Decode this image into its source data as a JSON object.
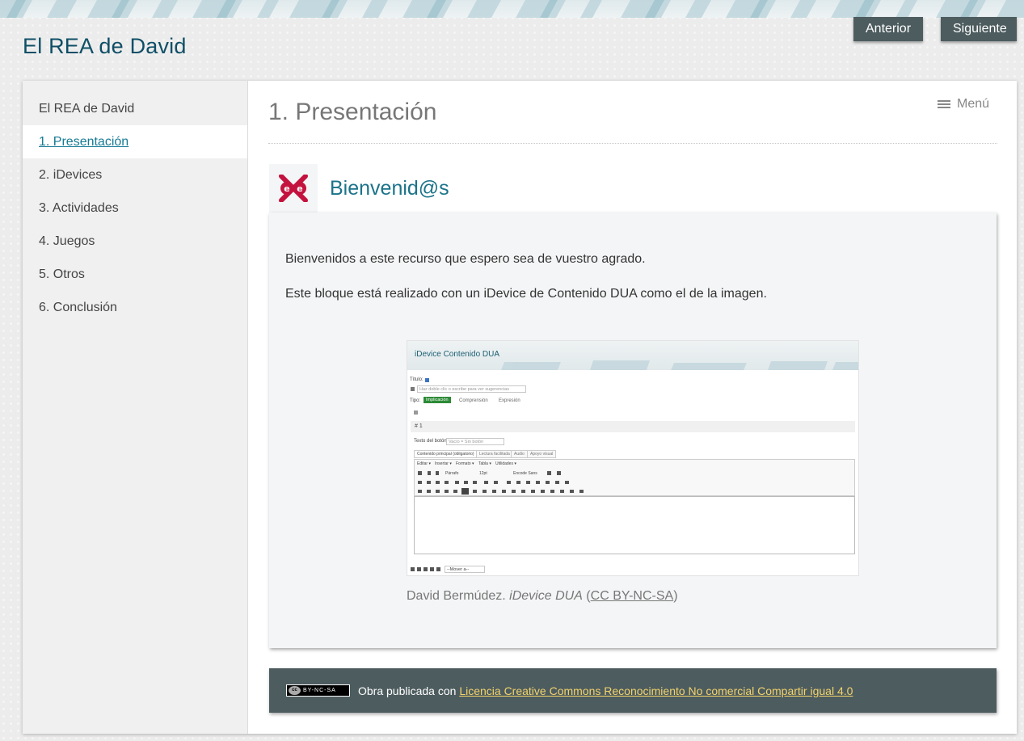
{
  "site": {
    "title": "El REA de David"
  },
  "nav": {
    "prev_label": "Anterior",
    "next_label": "Siguiente"
  },
  "sidebar": {
    "items": [
      {
        "label": "El REA de David"
      },
      {
        "label": "1. Presentación"
      },
      {
        "label": "2. iDevices"
      },
      {
        "label": "3. Actividades"
      },
      {
        "label": "4. Juegos"
      },
      {
        "label": "5. Otros"
      },
      {
        "label": "6. Conclusión"
      }
    ],
    "active_index": 1
  },
  "page": {
    "title": "1. Presentación",
    "menu_label": "Menú",
    "menu_icon": "hamburger-icon"
  },
  "idevice": {
    "icon": "exe-logo-icon",
    "title": "Bienvenid@s",
    "paragraphs": [
      "Bienvenidos a este recurso que espero sea de vuestro agrado.",
      "Este bloque está realizado con un iDevice de Contenido DUA como el de la imagen."
    ],
    "image": {
      "title": "iDevice Contenido DUA",
      "titulo_label": "Título:",
      "titulo_placeholder": "Haz doble clic o escribe para ver sugerencias",
      "tipo_label": "Tipo:",
      "tipo_options": [
        "Implicación",
        "Comprensión",
        "Expresión"
      ],
      "block_number": "# 1",
      "boton_label": "Texto del botón:",
      "boton_value": "Vacío = Sin botón",
      "tabs": [
        "Contenido principal (obligatorio)",
        "Lectura facilitada",
        "Audio",
        "Apoyo visual"
      ],
      "menus": [
        "Editar ▾",
        "Insertar ▾",
        "Formato ▾",
        "Tabla ▾",
        "Utilidades ▾"
      ],
      "format_select": "Párrafo",
      "size_select": "12pt",
      "font_select": "Encode Sans",
      "move_select": "--Mover a--"
    },
    "caption": {
      "author": "David Bermúdez. ",
      "work": "iDevice DUA",
      "open": " (",
      "license": "CC BY-NC-SA",
      "close": ")"
    }
  },
  "footer": {
    "badge_text": "BY-NC-SA",
    "badge_cc": "cc",
    "prefix": "Obra publicada con ",
    "link": "Licencia Creative Commons Reconocimiento No comercial Compartir igual 4.0"
  },
  "colors": {
    "title_blue": "#0f4f66",
    "accent_teal": "#1b7389",
    "button_bg": "#4d5c5f",
    "footer_link": "#f3d36b"
  }
}
